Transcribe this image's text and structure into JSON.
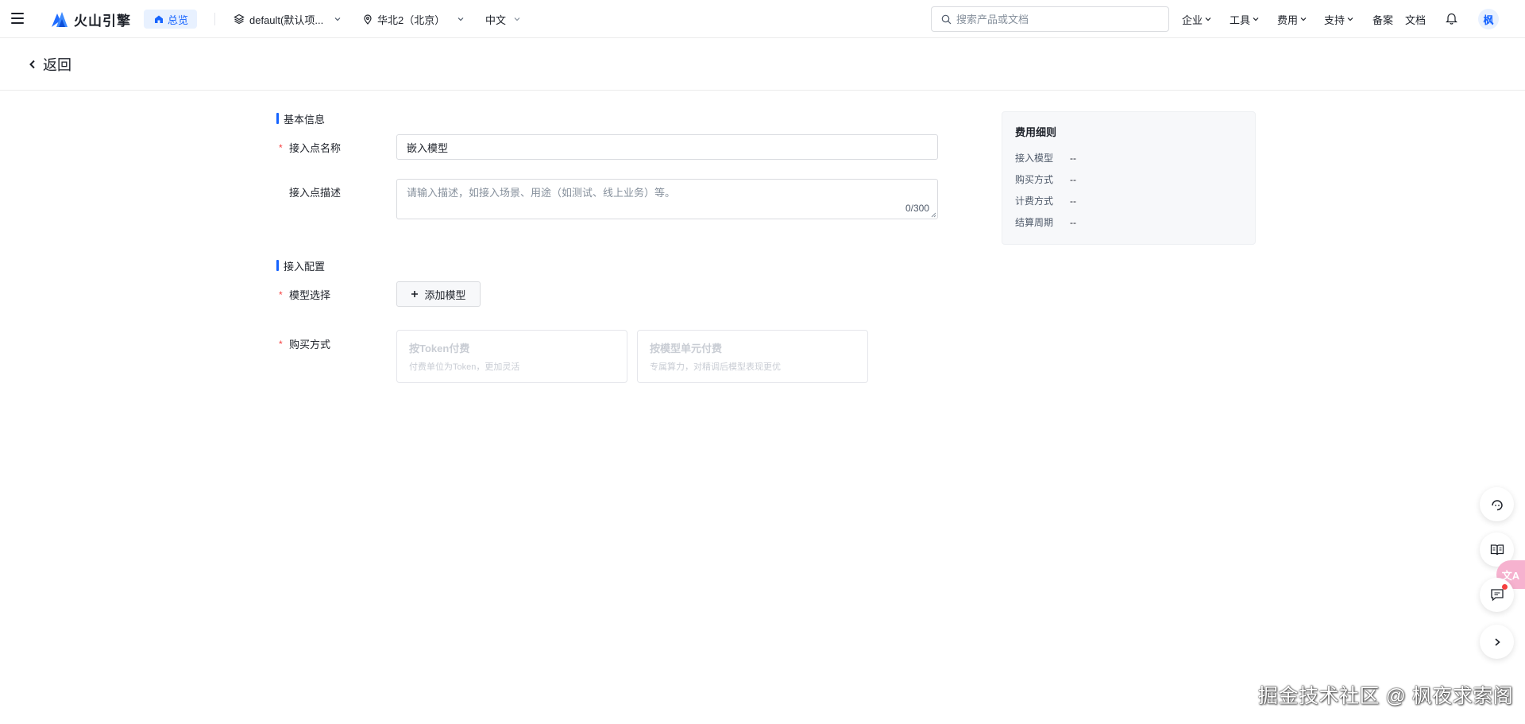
{
  "header": {
    "brand": "火山引擎",
    "overview": "总览",
    "project": "default(默认项...",
    "region": "华北2（北京）",
    "language": "中文",
    "search_placeholder": "搜索产品或文档",
    "menu": [
      "企业",
      "工具",
      "费用",
      "支持"
    ],
    "links": [
      "备案",
      "文档"
    ],
    "avatar_initial": "枫"
  },
  "back_label": "返回",
  "form": {
    "basic_info_title": "基本信息",
    "name_label": "接入点名称",
    "name_value": "嵌入模型",
    "desc_label": "接入点描述",
    "desc_placeholder": "请输入描述，如接入场景、用途（如测试、线上业务）等。",
    "desc_counter": "0/300",
    "config_title": "接入配置",
    "model_label": "模型选择",
    "add_model_label": "添加模型",
    "purchase_label": "购买方式",
    "purchase_options": [
      {
        "title": "按Token付费",
        "desc": "付费单位为Token，更加灵活"
      },
      {
        "title": "按模型单元付费",
        "desc": "专属算力，对精调后模型表现更优"
      }
    ]
  },
  "fee_panel": {
    "title": "费用细则",
    "rows": [
      {
        "key": "接入模型",
        "value": "--"
      },
      {
        "key": "购买方式",
        "value": "--"
      },
      {
        "key": "计费方式",
        "value": "--"
      },
      {
        "key": "结算周期",
        "value": "--"
      }
    ]
  },
  "side_float": {
    "translate_badge": "文A"
  },
  "watermark": "掘金技术社区 @ 枫夜求索阁",
  "colors": {
    "accent": "#1664ff",
    "required": "#f53f3f",
    "panel_bg": "#f7f8fa"
  }
}
